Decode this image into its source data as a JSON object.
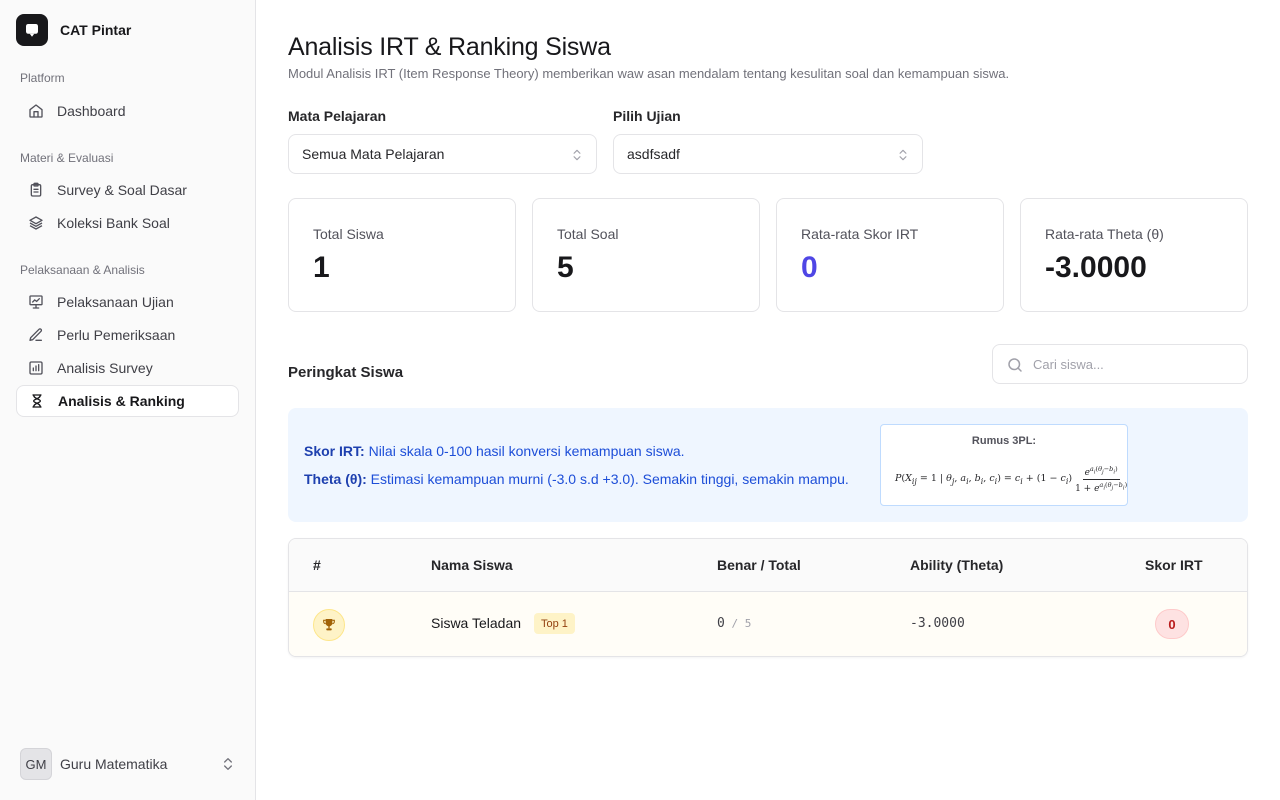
{
  "app": {
    "name": "CAT Pintar",
    "logo_icon": "message-square-icon"
  },
  "sidebar": {
    "groups": [
      {
        "label": "Platform",
        "items": [
          {
            "label": "Dashboard",
            "icon": "home-icon",
            "active": false
          }
        ]
      },
      {
        "label": "Materi & Evaluasi",
        "items": [
          {
            "label": "Survey & Soal Dasar",
            "icon": "clipboard-icon",
            "active": false
          },
          {
            "label": "Koleksi Bank Soal",
            "icon": "layers-icon",
            "active": false
          }
        ]
      },
      {
        "label": "Pelaksanaan & Analisis",
        "items": [
          {
            "label": "Pelaksanaan Ujian",
            "icon": "presentation-icon",
            "active": false
          },
          {
            "label": "Perlu Pemeriksaan",
            "icon": "edit-icon",
            "active": false
          },
          {
            "label": "Analisis Survey",
            "icon": "chart-icon",
            "active": false
          },
          {
            "label": "Analisis & Ranking",
            "icon": "hourglass-icon",
            "active": true
          }
        ]
      }
    ],
    "user": {
      "initials": "GM",
      "name": "Guru Matematika"
    }
  },
  "page": {
    "title": "Analisis IRT & Ranking Siswa",
    "description": "Modul Analisis IRT (Item Response Theory) memberikan waw asan mendalam tentang kesulitan soal dan kemampuan siswa."
  },
  "filters": {
    "subject": {
      "label": "Mata Pelajaran",
      "value": "Semua Mata Pelajaran"
    },
    "exam": {
      "label": "Pilih Ujian",
      "value": "asdfsadf"
    }
  },
  "stats": [
    {
      "label": "Total Siswa",
      "value": "1"
    },
    {
      "label": "Total Soal",
      "value": "5"
    },
    {
      "label": "Rata-rata Skor IRT",
      "value": "0"
    },
    {
      "label": "Rata-rata Theta (θ)",
      "value": "-3.0000"
    }
  ],
  "ranking": {
    "title": "Peringkat Siswa",
    "search_placeholder": "Cari siswa...",
    "info": {
      "skor_label": "Skor IRT:",
      "skor_text": " Nilai skala 0-100 hasil konversi kemampuan siswa.",
      "theta_label": "Theta (θ):",
      "theta_text": " Estimasi kemampuan murni (-3.0 s.d +3.0). Semakin tinggi, semakin mampu.",
      "formula_title": "Rumus 3PL:"
    },
    "columns": [
      "#",
      "Nama Siswa",
      "Benar / Total",
      "Ability (Theta)",
      "Skor IRT"
    ],
    "rows": [
      {
        "rank_icon": "trophy-icon",
        "name": "Siswa Teladan",
        "badge": "Top 1",
        "correct": "0",
        "total": "5",
        "theta": "-3.0000",
        "irt_score": "0"
      }
    ]
  },
  "colors": {
    "accent": "#4f46e5",
    "info_bg": "#eff6ff",
    "info_text": "#1d4ed8",
    "trophy_bg": "#fef3c7",
    "score_badge_bg": "#fee2e2",
    "score_badge_text": "#b91c1c"
  }
}
